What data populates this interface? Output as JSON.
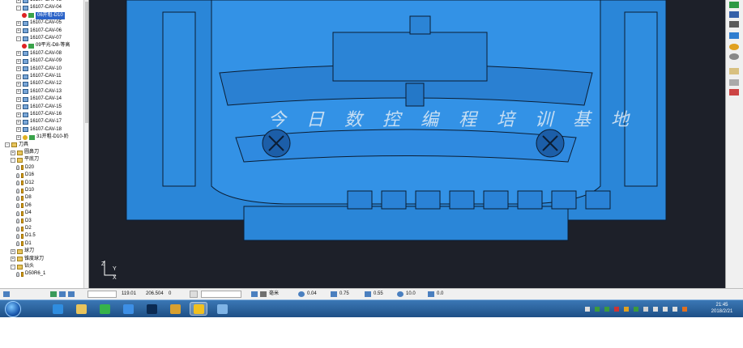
{
  "tree": {
    "items": [
      {
        "label": "16107-CAV-03",
        "indent": 2,
        "icon": "op",
        "expander": "+"
      },
      {
        "label": "16107-CAV-04",
        "indent": 2,
        "icon": "op",
        "expander": "-"
      },
      {
        "label": "06开粗-D10",
        "indent": 3,
        "icon": "toolpath",
        "status": "error",
        "selected": true
      },
      {
        "label": "16107-CAV-05",
        "indent": 2,
        "icon": "op",
        "expander": "+"
      },
      {
        "label": "16107-CAV-06",
        "indent": 2,
        "icon": "op",
        "expander": "+"
      },
      {
        "label": "16107-CAV-07",
        "indent": 2,
        "icon": "op",
        "expander": "-"
      },
      {
        "label": "09平光-D8-等高",
        "indent": 3,
        "icon": "toolpath",
        "status": "error"
      },
      {
        "label": "16107-CAV-08",
        "indent": 2,
        "icon": "op",
        "expander": "+"
      },
      {
        "label": "16107-CAV-09",
        "indent": 2,
        "icon": "op",
        "expander": "+"
      },
      {
        "label": "16107-CAV-10",
        "indent": 2,
        "icon": "op",
        "expander": "+"
      },
      {
        "label": "16107-CAV-11",
        "indent": 2,
        "icon": "op",
        "expander": "+"
      },
      {
        "label": "16107-CAV-12",
        "indent": 2,
        "icon": "op",
        "expander": "+"
      },
      {
        "label": "16107-CAV-13",
        "indent": 2,
        "icon": "op",
        "expander": "+"
      },
      {
        "label": "16107-CAV-14",
        "indent": 2,
        "icon": "op",
        "expander": "+"
      },
      {
        "label": "16107-CAV-15",
        "indent": 2,
        "icon": "op",
        "expander": "+"
      },
      {
        "label": "16107-CAV-16",
        "indent": 2,
        "icon": "op",
        "expander": "+"
      },
      {
        "label": "16107-CAV-17",
        "indent": 2,
        "icon": "op",
        "expander": "+"
      },
      {
        "label": "16107-CAV-18",
        "indent": 2,
        "icon": "op",
        "expander": "+"
      },
      {
        "label": "31开粗-D10-奶",
        "indent": 2,
        "icon": "toolpath",
        "status": "warn",
        "expander": "+"
      },
      {
        "label": "刀具",
        "indent": 0,
        "icon": "tools",
        "expander": "-"
      },
      {
        "label": "圆鼻刀",
        "indent": 1,
        "icon": "folder",
        "expander": "+"
      },
      {
        "label": "平底刀",
        "indent": 1,
        "icon": "folder",
        "expander": "-"
      },
      {
        "label": "D20",
        "indent": 2,
        "icon": "tool"
      },
      {
        "label": "D16",
        "indent": 2,
        "icon": "tool"
      },
      {
        "label": "D12",
        "indent": 2,
        "icon": "tool"
      },
      {
        "label": "D10",
        "indent": 2,
        "icon": "tool"
      },
      {
        "label": "D8",
        "indent": 2,
        "icon": "tool"
      },
      {
        "label": "D6",
        "indent": 2,
        "icon": "tool"
      },
      {
        "label": "D4",
        "indent": 2,
        "icon": "tool"
      },
      {
        "label": "D3",
        "indent": 2,
        "icon": "tool"
      },
      {
        "label": "D2",
        "indent": 2,
        "icon": "tool"
      },
      {
        "label": "D1.5",
        "indent": 2,
        "icon": "tool"
      },
      {
        "label": "D1",
        "indent": 2,
        "icon": "tool"
      },
      {
        "label": "球刀",
        "indent": 1,
        "icon": "folder",
        "expander": "+"
      },
      {
        "label": "锥度球刀",
        "indent": 1,
        "icon": "folder",
        "expander": "+"
      },
      {
        "label": "钻头",
        "indent": 1,
        "icon": "folder",
        "expander": "-"
      },
      {
        "label": "D50R6_1",
        "indent": 2,
        "icon": "tool"
      }
    ]
  },
  "viewport": {
    "watermark": "今 日 数 控 编 程 培 训 基 地",
    "model_color": "#2a86d8",
    "background_color": "#1d2029",
    "axis": {
      "x": "X",
      "y": "Y",
      "z": "Z"
    }
  },
  "statusbar": {
    "coord_x": "119.01",
    "coord_y": "206.504",
    "coord_z": "0",
    "unit": "毫米",
    "tolerance": "0.04",
    "thickness": "0.75",
    "value3": "0.55",
    "diameter": "10.0",
    "angle": "0.0"
  },
  "taskbar": {
    "time": "21:45",
    "date": "2018/2/21",
    "apps": [
      "ie-icon",
      "folder-icon",
      "360-icon",
      "baidu-cloud-icon",
      "photoshop-icon",
      "user-icon",
      "powermill-icon",
      "window-icon"
    ],
    "active_app": "powermill-icon"
  }
}
